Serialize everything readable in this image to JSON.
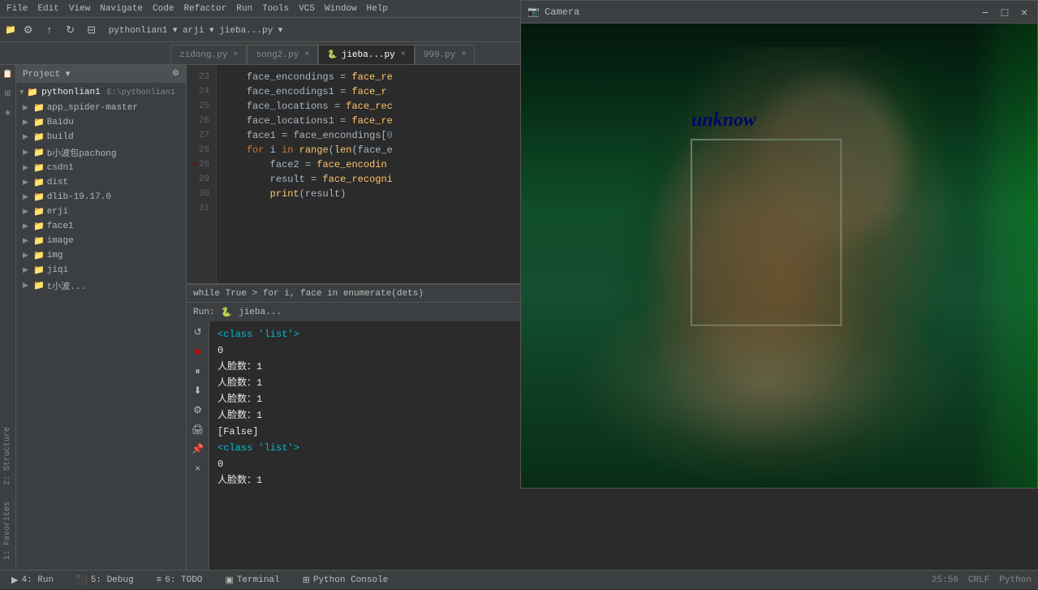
{
  "app": {
    "title": "pythonlian1",
    "project_label": "pythonlian1",
    "python_path": "E:\\pythonlian1"
  },
  "menubar": {
    "items": [
      "File",
      "Edit",
      "View",
      "Navigate",
      "Code",
      "Refactor",
      "Run",
      "Tools",
      "VCS",
      "Window",
      "Help"
    ]
  },
  "toolbar": {
    "breadcrumb": "pythonlian1 ▾  arji ▾  jieba...py ▾"
  },
  "tabs": [
    {
      "id": "zidong",
      "label": "zidong.py",
      "active": false,
      "closable": true
    },
    {
      "id": "song2",
      "label": "song2.py",
      "active": false,
      "closable": true
    },
    {
      "id": "jieba",
      "label": "jieba...py",
      "active": true,
      "closable": true
    },
    {
      "id": "999",
      "label": "999.py",
      "active": false,
      "closable": true
    }
  ],
  "sidebar": {
    "header": "Project ▾",
    "tree": [
      {
        "indent": 0,
        "icon": "▼",
        "type": "root",
        "label": "pythonlian1",
        "path": "E:\\pythonlian1"
      },
      {
        "indent": 1,
        "icon": "▶",
        "type": "folder",
        "label": "app_spider-master"
      },
      {
        "indent": 1,
        "icon": "▶",
        "type": "folder",
        "label": "Baidu"
      },
      {
        "indent": 1,
        "icon": "▶",
        "type": "folder",
        "label": "build"
      },
      {
        "indent": 1,
        "icon": "▶",
        "type": "folder",
        "label": "b小波包pachong"
      },
      {
        "indent": 1,
        "icon": "▶",
        "type": "folder",
        "label": "csdn1"
      },
      {
        "indent": 1,
        "icon": "▶",
        "type": "folder",
        "label": "dist"
      },
      {
        "indent": 1,
        "icon": "▶",
        "type": "folder",
        "label": "dlib-19.17.0"
      },
      {
        "indent": 1,
        "icon": "▶",
        "type": "folder",
        "label": "erji"
      },
      {
        "indent": 1,
        "icon": "▶",
        "type": "folder",
        "label": "face1"
      },
      {
        "indent": 1,
        "icon": "▶",
        "type": "folder",
        "label": "image"
      },
      {
        "indent": 1,
        "icon": "▶",
        "type": "folder",
        "label": "img"
      },
      {
        "indent": 1,
        "icon": "▶",
        "type": "folder",
        "label": "jiqi"
      },
      {
        "indent": 1,
        "icon": "▶",
        "type": "folder",
        "label": "t小波..."
      }
    ]
  },
  "code": {
    "lines": [
      {
        "num": 23,
        "text": "    face_encondings = face_re"
      },
      {
        "num": 24,
        "text": "    face_encodings1 = face_r"
      },
      {
        "num": 25,
        "text": "    face_locations = face_rec"
      },
      {
        "num": 26,
        "text": "    face_locations1 = face_re"
      },
      {
        "num": 27,
        "text": "    face1 = face_encondings[0"
      },
      {
        "num": 28,
        "text": "    for i in range(len(face_e"
      },
      {
        "num": 29,
        "text": "        face2 = face_encodin"
      },
      {
        "num": 30,
        "text": "        result = face_recogni"
      },
      {
        "num": 31,
        "text": "        print(result)"
      }
    ],
    "breadcrumb": "while True  >  for i, face in enumerate(dets)"
  },
  "run": {
    "label": "Run:",
    "file": "jieba...",
    "output_lines": [
      "<class 'list'>",
      "0",
      "人脸数：1",
      "人脸数：1",
      "人脸数：1",
      "人脸数：1",
      "[False]",
      "<class 'list'>",
      "0",
      "人脸数：1"
    ]
  },
  "camera": {
    "title": "Camera",
    "unknow_label": "unknow",
    "window_controls": [
      "−",
      "□",
      "×"
    ]
  },
  "statusbar": {
    "tabs": [
      {
        "id": "run",
        "label": "4: Run",
        "icon": "▶",
        "active": false
      },
      {
        "id": "debug",
        "label": "5: Debug",
        "icon": "⬛",
        "active": false
      },
      {
        "id": "todo",
        "label": "6: TODO",
        "icon": "≡",
        "active": false
      },
      {
        "id": "terminal",
        "label": "Terminal",
        "icon": "▣",
        "active": false
      },
      {
        "id": "python-console",
        "label": "Python Console",
        "icon": "⊞",
        "active": false
      }
    ],
    "right": {
      "position": "25:56",
      "encoding": "CRLF",
      "lang": "Python"
    }
  }
}
